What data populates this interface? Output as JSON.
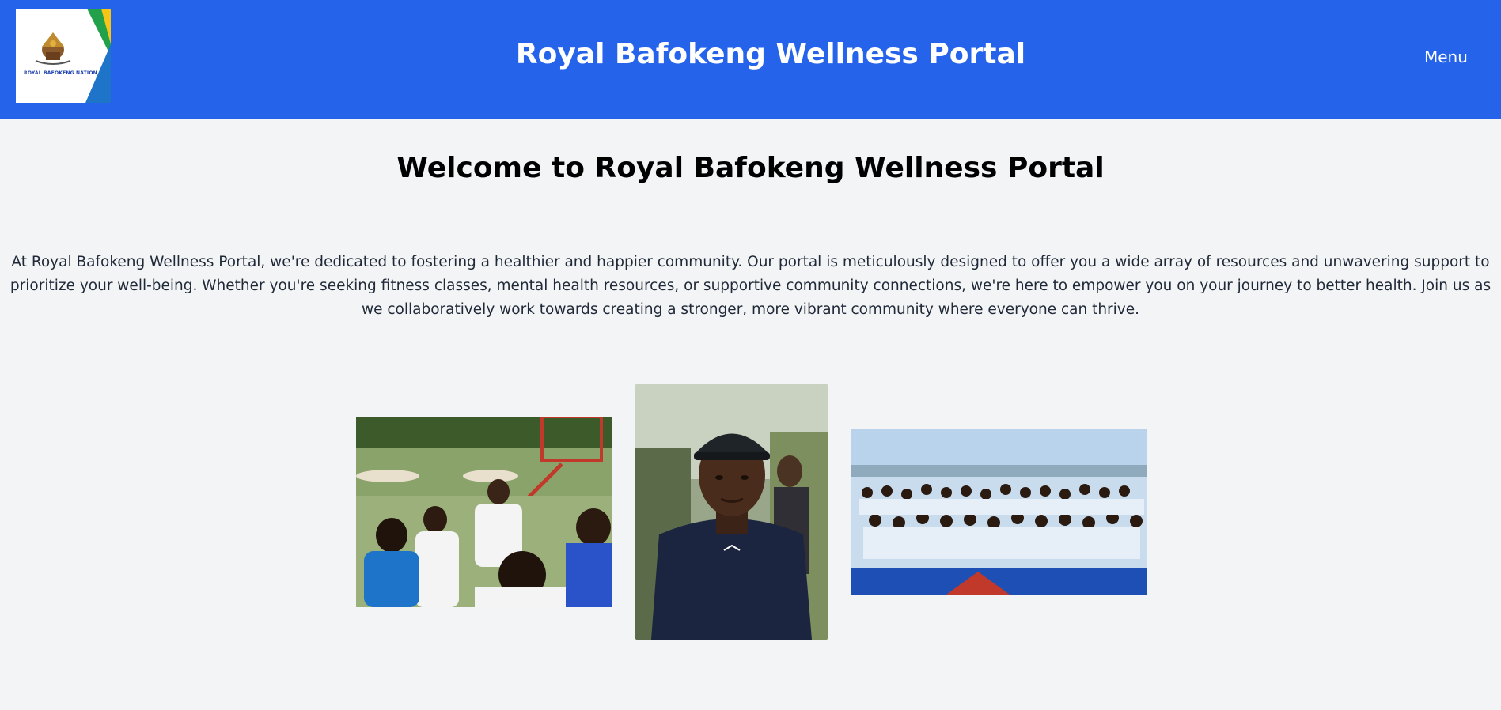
{
  "header": {
    "logo_text": "ROYAL BAFOKENG NATION",
    "title": "Royal Bafokeng Wellness Portal",
    "menu_label": "Menu",
    "background_color": "#2563eb"
  },
  "main": {
    "heading": "Welcome to Royal Bafokeng Wellness Portal",
    "intro": "At Royal Bafokeng Wellness Portal, we're dedicated to fostering a healthier and happier community. Our portal is meticulously designed to offer you a wide array of resources and unwavering support to prioritize your well-being. Whether you're seeking fitness classes, mental health resources, or supportive community connections, we're here to empower you on your journey to better health. Join us as we collaboratively work towards creating a stronger, more vibrant community where everyone can thrive."
  },
  "gallery": {
    "images": [
      {
        "name": "basketball-team-huddle-photo"
      },
      {
        "name": "man-in-cap-portrait-photo"
      },
      {
        "name": "community-group-celebration-photo"
      }
    ]
  }
}
